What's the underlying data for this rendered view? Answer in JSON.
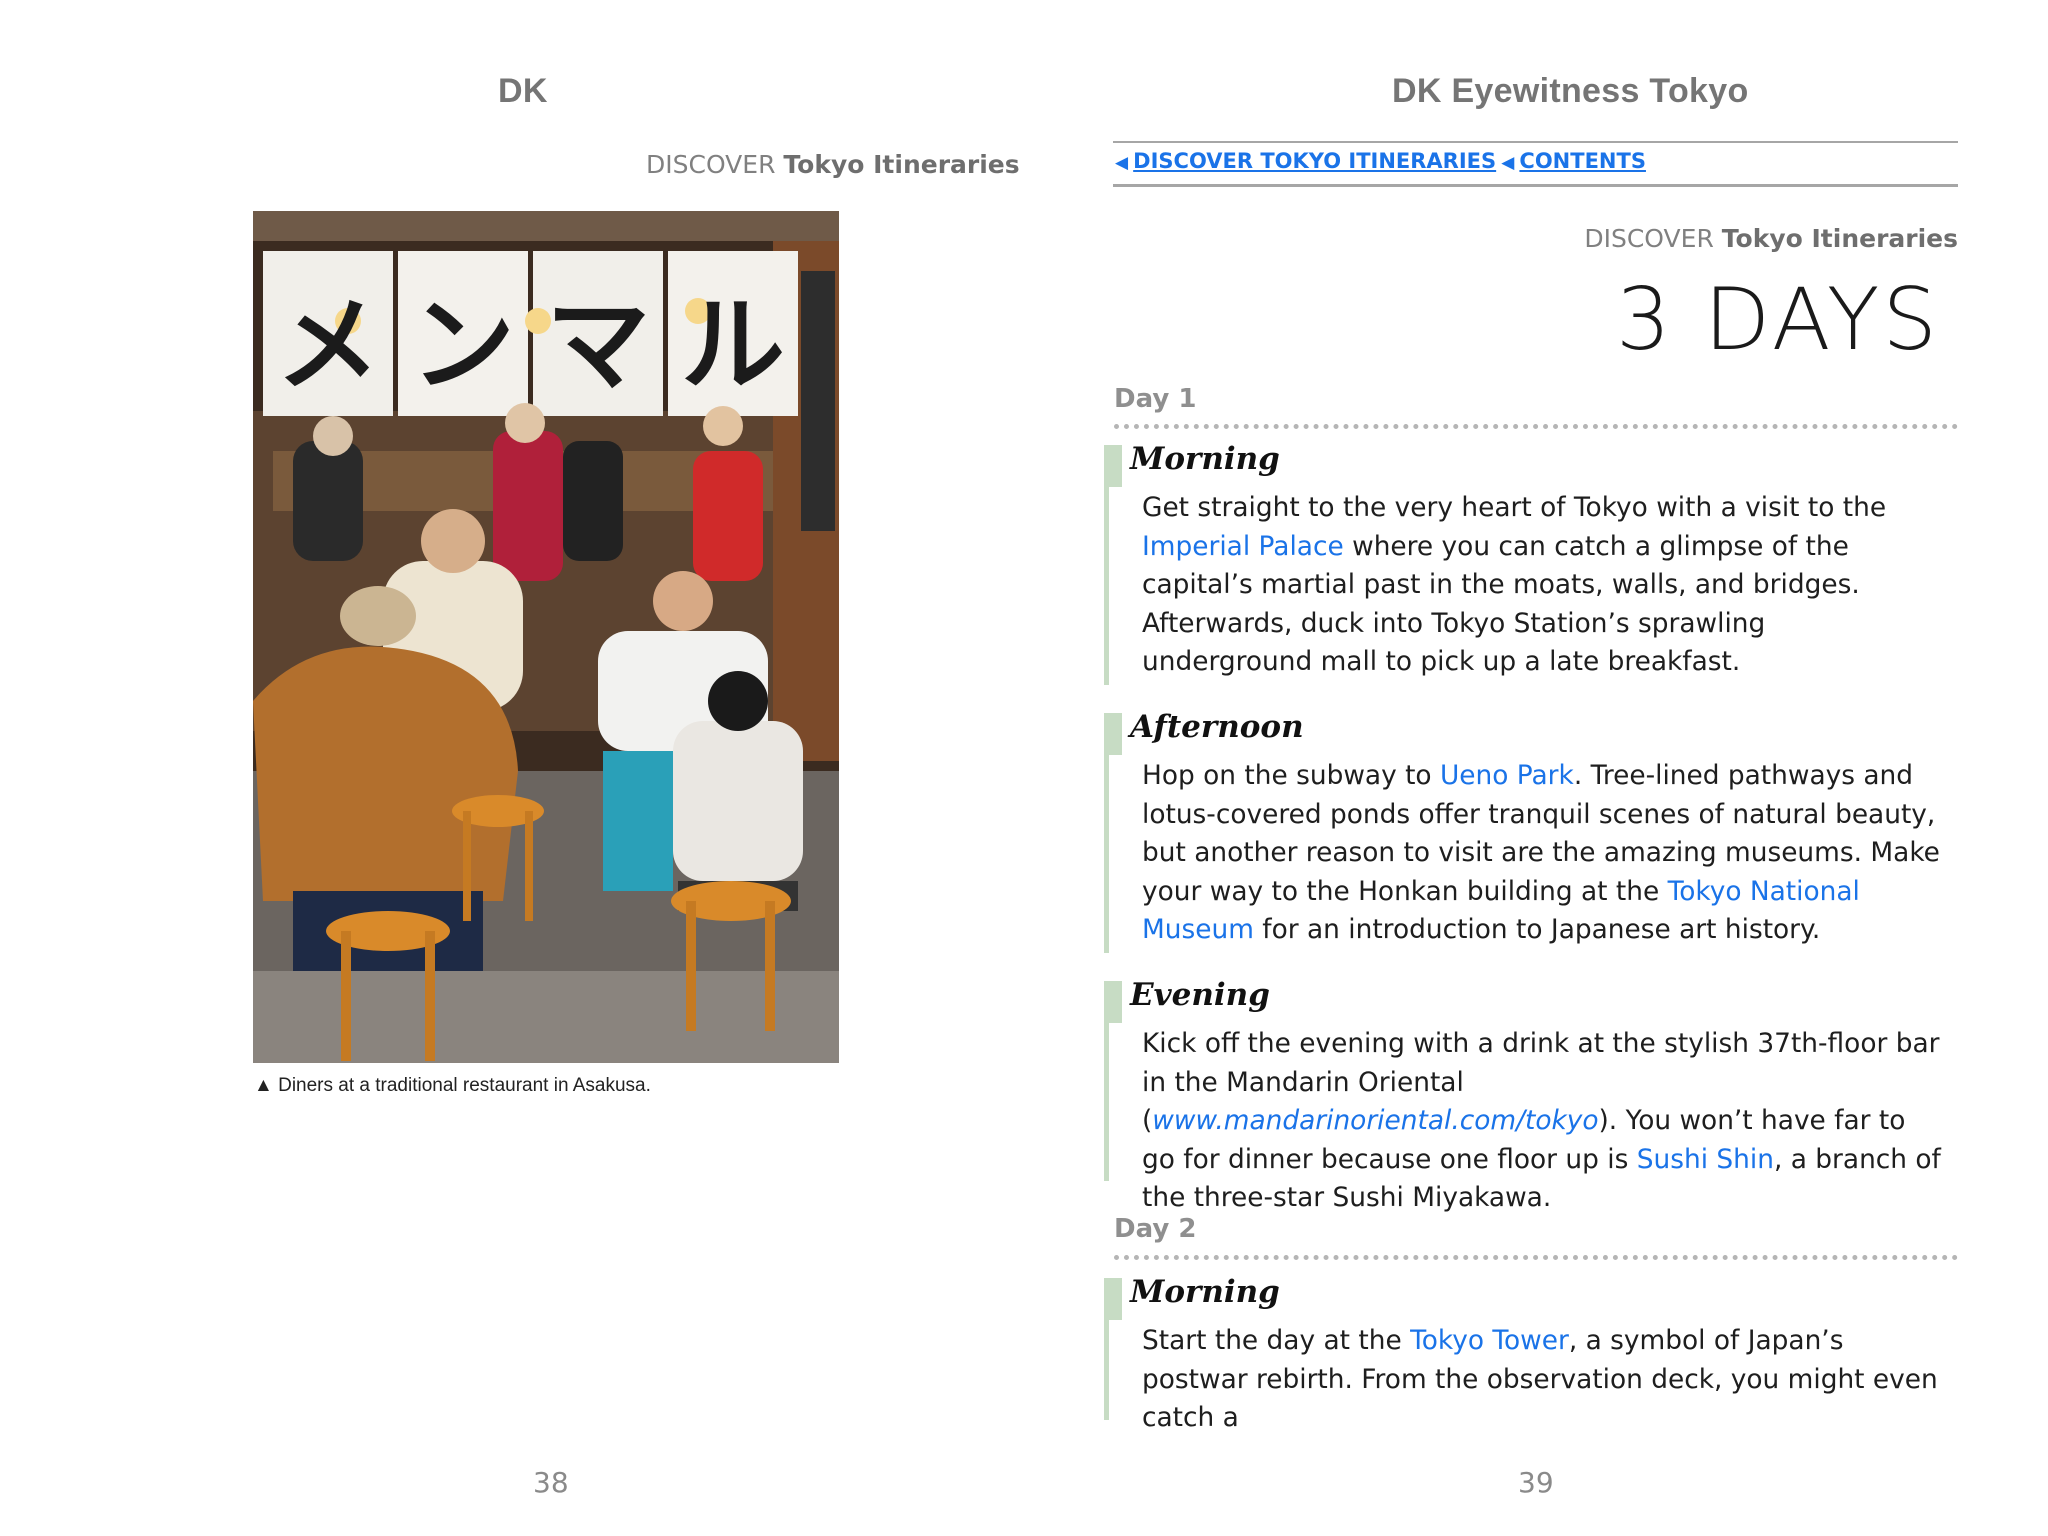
{
  "left_page": {
    "publisher": "DK",
    "section": {
      "prefix": "DISCOVER",
      "title": "Tokyo Itineraries"
    },
    "photo": {
      "sign_chars": [
        "メ",
        "ン",
        "マ",
        "ル"
      ]
    },
    "caption": {
      "marker": "▲",
      "text": "Diners at a traditional restaurant in Asakusa."
    },
    "page_number": "38"
  },
  "right_page": {
    "book_title": "DK Eyewitness Tokyo",
    "nav": {
      "arrow": "◀",
      "link1": "DISCOVER TOKYO ITINERARIES",
      "link2": "CONTENTS"
    },
    "section": {
      "prefix": "DISCOVER",
      "title": "Tokyo Itineraries"
    },
    "title": "3 DAYS",
    "day1": {
      "label": "Day 1",
      "morning": {
        "heading": "Morning",
        "t1": "Get straight to the very heart of Tokyo with a visit to the ",
        "l1": "Imperial Palace",
        "t2": " where you can catch a glimpse of the capital’s martial past in the moats, walls, and bridges. Afterwards, duck into Tokyo Station’s sprawling underground mall to pick up a late breakfast."
      },
      "afternoon": {
        "heading": "Afternoon",
        "t1": "Hop on the subway to ",
        "l1": "Ueno Park",
        "t2": ". Tree-lined pathways and lotus-covered ponds offer tranquil scenes of natural beauty, but another reason to visit are the amazing museums. Make your way to the Honkan building at the ",
        "l2": "Tokyo National Museum",
        "t3": " for an introduction to Japanese art history."
      },
      "evening": {
        "heading": "Evening",
        "t1": "Kick off the evening with a drink at the stylish 37th-floor bar in the Mandarin Oriental (",
        "l1": "www.mandarinoriental.com/tokyo",
        "t2": "). You won’t have far to go for dinner because one floor up is ",
        "l2": "Sushi Shin",
        "t3": ", a branch of the three-star Sushi Miyakawa."
      }
    },
    "day2": {
      "label": "Day 2",
      "morning": {
        "heading": "Morning",
        "t1": "Start the day at the ",
        "l1": "Tokyo Tower",
        "t2": ", a symbol of Japan’s postwar rebirth. From the observation deck, you might even catch a"
      }
    },
    "page_number": "39"
  },
  "colors": {
    "link": "#1a73e8",
    "section_bar": "#c7dcc4",
    "header_grey": "#757575"
  }
}
